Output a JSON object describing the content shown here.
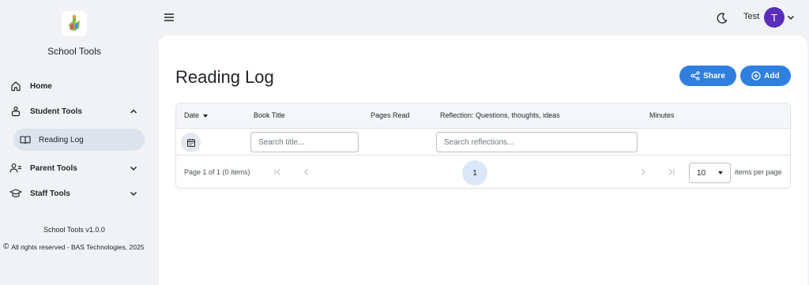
{
  "app": {
    "name": "School Tools",
    "version": "School Tools v1.0.0",
    "copyright": "All rights reserved - BAS Technologies, 2025"
  },
  "sidebar": {
    "items": [
      {
        "label": "Home",
        "icon": "home-icon"
      },
      {
        "label": "Student Tools",
        "icon": "student-icon",
        "expanded": true
      },
      {
        "label": "Reading Log",
        "icon": "book-icon",
        "active": true
      },
      {
        "label": "Parent Tools",
        "icon": "parent-icon",
        "expanded": false
      },
      {
        "label": "Staff Tools",
        "icon": "graduation-cap-icon",
        "expanded": false
      }
    ]
  },
  "header": {
    "user_name": "Test",
    "avatar_initial": "T"
  },
  "page": {
    "title": "Reading Log",
    "share_label": "Share",
    "add_label": "Add"
  },
  "grid": {
    "columns": [
      "Date",
      "Book Title",
      "Pages Read",
      "Reflection: Questions, thoughts, ideas",
      "Minutes"
    ],
    "filters": {
      "title_placeholder": "Search title...",
      "reflection_placeholder": "Search reflections..."
    },
    "rows": []
  },
  "pager": {
    "info": "Page 1 of 1 (0 items)",
    "current_page": "1",
    "page_size": "10",
    "page_size_label": "items per page"
  },
  "colors": {
    "accent": "#2f7fdf",
    "avatar": "#5a2dbb",
    "active_nav": "#dde3ec",
    "background": "#f0f2f5"
  }
}
